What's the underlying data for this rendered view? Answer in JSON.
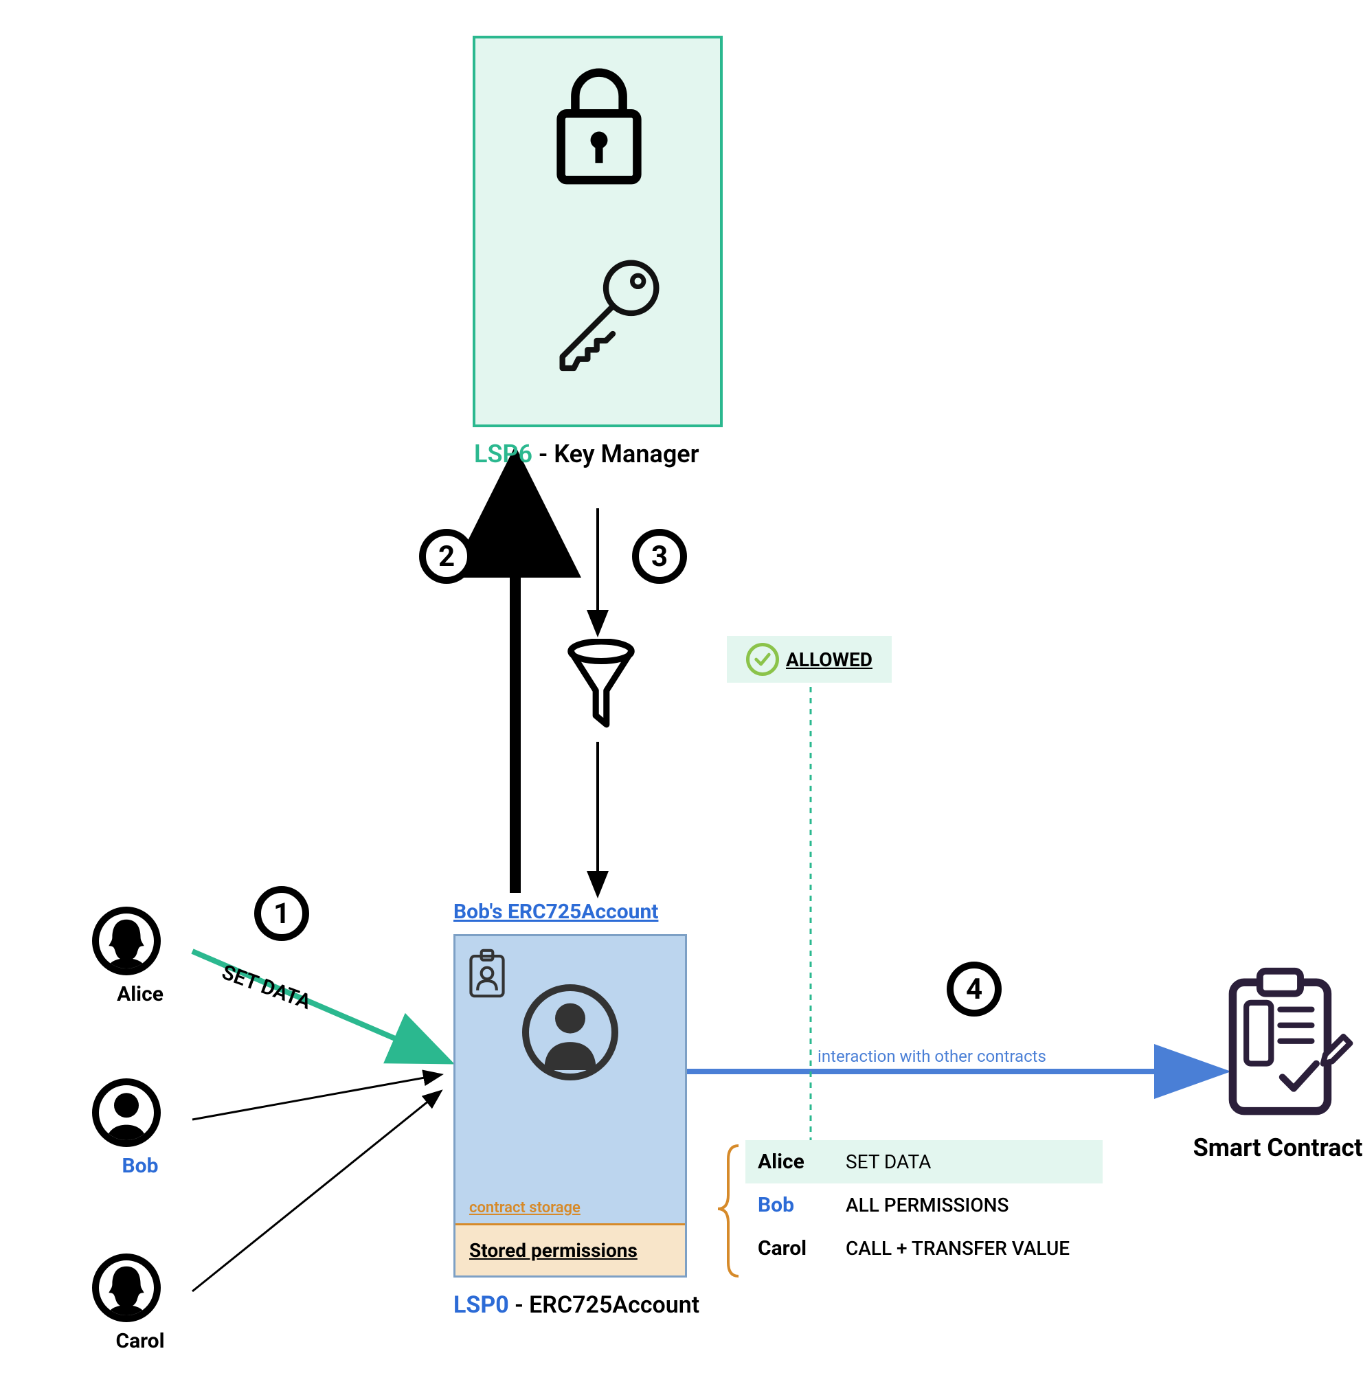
{
  "keyManager": {
    "lsp": "LSP6",
    "title": " - Key Manager"
  },
  "steps": {
    "one": "1",
    "two": "2",
    "three": "3",
    "four": "4"
  },
  "allowed": "ALLOWED",
  "users": {
    "alice": "Alice",
    "bob": "Bob",
    "carol": "Carol"
  },
  "action": "SET DATA",
  "account": {
    "link": "Bob's ERC725Account",
    "storageLabel": "contract storage",
    "storedPermissions": "Stored permissions",
    "lsp": "LSP0",
    "title": " - ERC725Account"
  },
  "interaction": "interaction with other contracts",
  "permissions": {
    "alice": {
      "name": "Alice",
      "value": "SET DATA"
    },
    "bob": {
      "name": "Bob",
      "value": "ALL PERMISSIONS"
    },
    "carol": {
      "name": "Carol",
      "value": "CALL + TRANSFER VALUE"
    }
  },
  "smartContract": "Smart Contract"
}
